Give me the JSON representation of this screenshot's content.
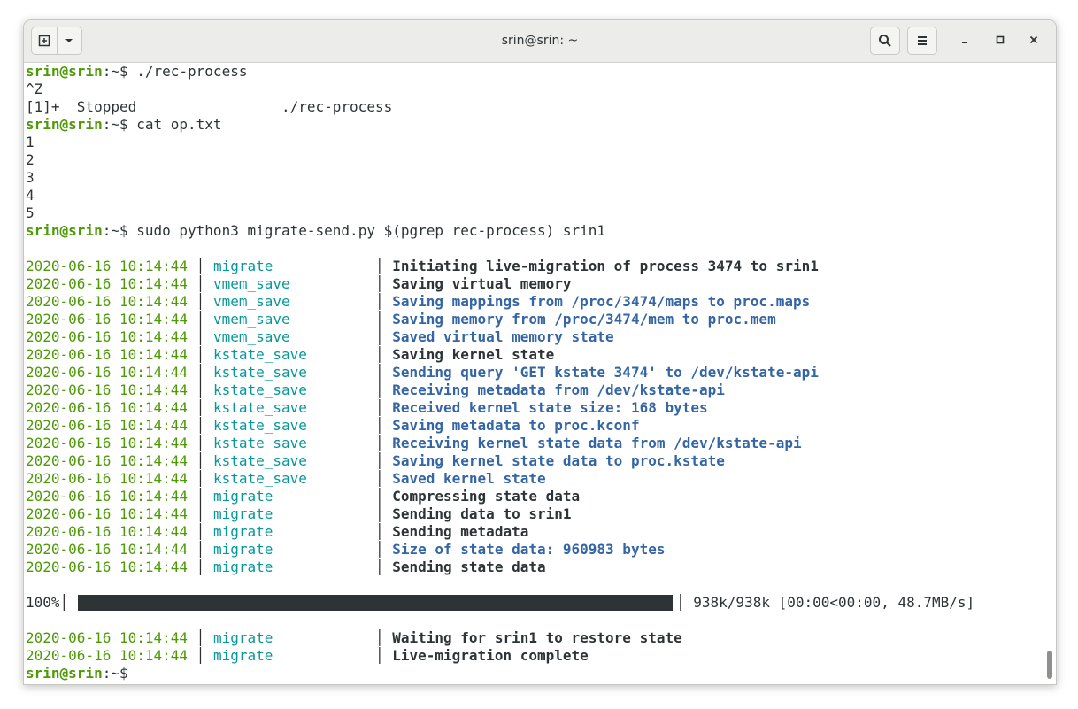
{
  "window": {
    "title": "srin@srin: ~"
  },
  "prompt": {
    "user": "srin@srin",
    "path": ":~",
    "symbol": "$ "
  },
  "terminal": {
    "pre_lines": [
      {
        "prompt": true,
        "cmd": "./rec-process"
      },
      {
        "text": "^Z"
      },
      {
        "text": "[1]+  Stopped                 ./rec-process"
      },
      {
        "prompt": true,
        "cmd": "cat op.txt"
      },
      {
        "text": "1"
      },
      {
        "text": "2"
      },
      {
        "text": "3"
      },
      {
        "text": "4"
      },
      {
        "text": "5"
      },
      {
        "prompt": true,
        "cmd": "sudo python3 migrate-send.py $(pgrep rec-process) srin1"
      }
    ],
    "log": [
      {
        "ts": "2020-06-16 10:14:44",
        "mod": "migrate",
        "msg": "Initiating live-migration of process 3474 to srin1",
        "style": "bold"
      },
      {
        "ts": "2020-06-16 10:14:44",
        "mod": "vmem_save",
        "msg": "Saving virtual memory",
        "style": "bold"
      },
      {
        "ts": "2020-06-16 10:14:44",
        "mod": "vmem_save",
        "msg": "Saving mappings from /proc/3474/maps to proc.maps",
        "style": "info"
      },
      {
        "ts": "2020-06-16 10:14:44",
        "mod": "vmem_save",
        "msg": "Saving memory from /proc/3474/mem to proc.mem",
        "style": "info"
      },
      {
        "ts": "2020-06-16 10:14:44",
        "mod": "vmem_save",
        "msg": "Saved virtual memory state",
        "style": "info"
      },
      {
        "ts": "2020-06-16 10:14:44",
        "mod": "kstate_save",
        "msg": "Saving kernel state",
        "style": "bold"
      },
      {
        "ts": "2020-06-16 10:14:44",
        "mod": "kstate_save",
        "msg": "Sending query 'GET kstate 3474' to /dev/kstate-api",
        "style": "info"
      },
      {
        "ts": "2020-06-16 10:14:44",
        "mod": "kstate_save",
        "msg": "Receiving metadata from /dev/kstate-api",
        "style": "info"
      },
      {
        "ts": "2020-06-16 10:14:44",
        "mod": "kstate_save",
        "msg": "Received kernel state size: 168 bytes",
        "style": "info"
      },
      {
        "ts": "2020-06-16 10:14:44",
        "mod": "kstate_save",
        "msg": "Saving metadata to proc.kconf",
        "style": "info"
      },
      {
        "ts": "2020-06-16 10:14:44",
        "mod": "kstate_save",
        "msg": "Receiving kernel state data from /dev/kstate-api",
        "style": "info"
      },
      {
        "ts": "2020-06-16 10:14:44",
        "mod": "kstate_save",
        "msg": "Saving kernel state data to proc.kstate",
        "style": "info"
      },
      {
        "ts": "2020-06-16 10:14:44",
        "mod": "kstate_save",
        "msg": "Saved kernel state",
        "style": "info"
      },
      {
        "ts": "2020-06-16 10:14:44",
        "mod": "migrate",
        "msg": "Compressing state data",
        "style": "bold"
      },
      {
        "ts": "2020-06-16 10:14:44",
        "mod": "migrate",
        "msg": "Sending data to srin1",
        "style": "bold"
      },
      {
        "ts": "2020-06-16 10:14:44",
        "mod": "migrate",
        "msg": "Sending metadata",
        "style": "bold"
      },
      {
        "ts": "2020-06-16 10:14:44",
        "mod": "migrate",
        "msg": "Size of state data: 960983 bytes",
        "style": "info"
      },
      {
        "ts": "2020-06-16 10:14:44",
        "mod": "migrate",
        "msg": "Sending state data",
        "style": "bold"
      }
    ],
    "progress": {
      "percent_label": "100%",
      "fraction": 1.0,
      "stats": "938k/938k [00:00<00:00, 48.7MB/s]"
    },
    "log2": [
      {
        "ts": "2020-06-16 10:14:44",
        "mod": "migrate",
        "msg": "Waiting for srin1 to restore state",
        "style": "bold"
      },
      {
        "ts": "2020-06-16 10:14:44",
        "mod": "migrate",
        "msg": "Live-migration complete",
        "style": "bold"
      }
    ]
  },
  "colors": {
    "prompt": "#4e9a06",
    "timestamp": "#4e9a06",
    "module": "#06989a",
    "info": "#3465a4",
    "bold": "#2e3436"
  }
}
